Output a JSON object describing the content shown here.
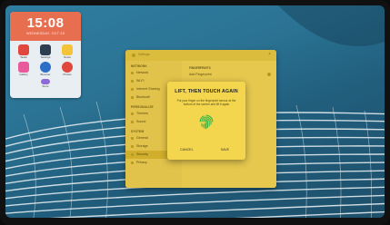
{
  "widget": {
    "time": "15:08",
    "date": "WEDNESDAY, OCT 25",
    "apps": [
      {
        "label": "Tasks",
        "icon": "tasks-icon",
        "color": "#e0473d"
      },
      {
        "label": "Settings",
        "icon": "gear-icon",
        "color": "#2c3e50"
      },
      {
        "label": "Notes",
        "icon": "notes-icon",
        "color": "#f3c43a"
      },
      {
        "label": "Gallery",
        "icon": "gallery-icon",
        "color": "#e85a9b"
      },
      {
        "label": "Browser",
        "icon": "globe-icon",
        "color": "#2b6fc7"
      },
      {
        "label": "Photos",
        "icon": "photos-icon",
        "color": "#e0473d"
      },
      {
        "label": "",
        "icon": "blank-icon",
        "color": "#e8eef1"
      },
      {
        "label": "Store",
        "icon": "store-icon",
        "color": "#8e6ad8"
      },
      {
        "label": "",
        "icon": "blank-icon",
        "color": "#e8eef1"
      }
    ]
  },
  "settings": {
    "title": "Settings",
    "close": "×",
    "sections": [
      {
        "name": "NETWORK",
        "items": [
          "Network",
          "Wi-Fi",
          "Internet Sharing",
          "Bluetooth"
        ]
      },
      {
        "name": "PERSONALIZE",
        "items": [
          "Themes",
          "Sound"
        ]
      },
      {
        "name": "SYSTEM",
        "items": [
          "General",
          "Storage",
          "Security",
          "Privacy"
        ]
      }
    ],
    "active_item": "Security",
    "pane": {
      "header": "FINGERPRINTS",
      "rows": [
        "Add Fingerprint"
      ]
    }
  },
  "dialog": {
    "title": "LIFT, THEN TOUCH AGAIN",
    "description": "Put your finger on the fingerprint sensor at the bottom of the screen and lift it again",
    "cancel": "CANCEL",
    "save": "SAVE",
    "icon": "fingerprint-icon",
    "accent": "#35b84a"
  }
}
